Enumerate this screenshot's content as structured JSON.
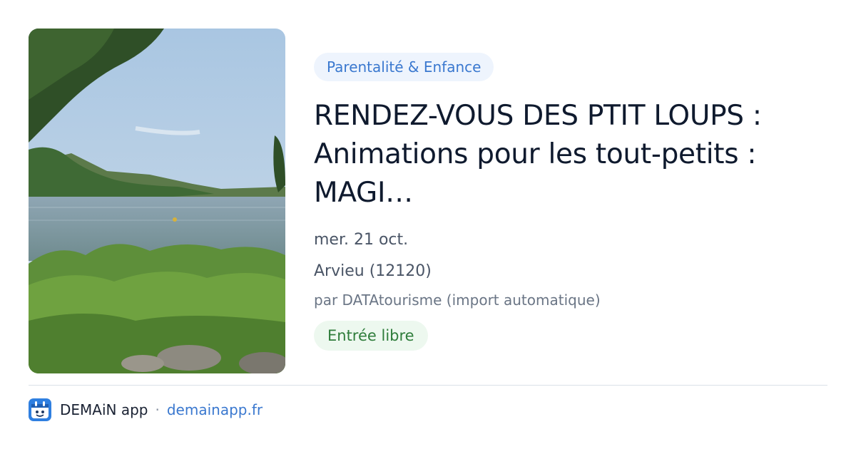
{
  "category": "Parentalité & Enfance",
  "title_lines": [
    "RENDEZ-VOUS DES PTIT LOUPS :",
    "Animations pour les tout-petits :",
    "MAGI…"
  ],
  "date": "mer. 21 oct.",
  "location": "Arvieu (12120)",
  "author": "par DATAtourisme (import automatique)",
  "price": "Entrée libre",
  "footer": {
    "app_name": "DEMAiN app",
    "separator": "·",
    "domain": "demainapp.fr",
    "icon": "demain-app-logo-icon"
  },
  "photo": {
    "subject": "lake-landscape-photo"
  },
  "colors": {
    "category_bg": "#eef4fd",
    "category_text": "#3a78cf",
    "price_bg": "#edf8ef",
    "price_text": "#2f7d3b",
    "title_text": "#0f1a2e",
    "link": "#3a78cf"
  }
}
